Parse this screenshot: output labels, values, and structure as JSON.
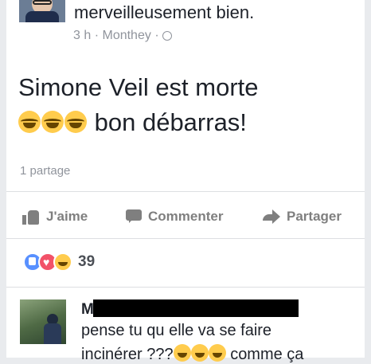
{
  "post": {
    "header_text": "merveilleusement bien.",
    "time": "3 h",
    "separator": "·",
    "location": "Monthey",
    "separator2": "·",
    "body_line1": "Simone Veil est morte",
    "body_line2_text": "bon débarras!",
    "body_emojis": [
      "face-with-tears-of-joy",
      "face-with-tears-of-joy",
      "face-with-tears-of-joy"
    ],
    "share_count": "1 partage"
  },
  "actions": {
    "like_label": "J'aime",
    "comment_label": "Commenter",
    "share_label": "Partager"
  },
  "reactions": {
    "types": [
      "like",
      "love",
      "haha"
    ],
    "count": "39"
  },
  "comment": {
    "name_initial": "M",
    "line1": "pense tu qu elle va se faire",
    "line2_start": "incinérer ???",
    "line2_end": "comme ça"
  },
  "colors": {
    "text_primary": "#1d2129",
    "text_secondary": "#90949c",
    "action_gray": "#7f7f7f",
    "like_blue": "#5890ff",
    "love_red": "#f25268",
    "emoji_yellow": "#ffcc4d"
  }
}
